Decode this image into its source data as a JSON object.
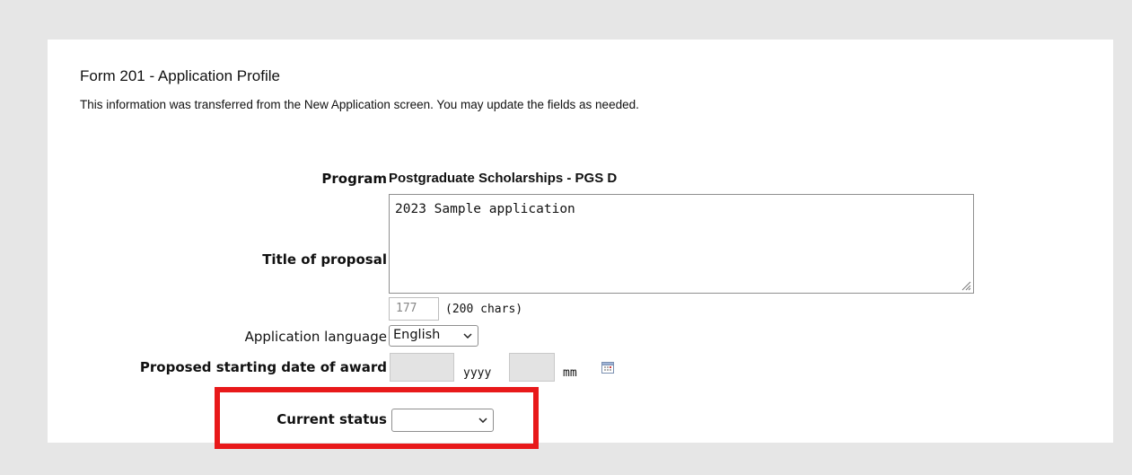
{
  "form": {
    "title": "Form 201 - Application Profile",
    "intro": "This information was transferred from the New Application screen. You may update the fields as needed."
  },
  "program": {
    "label": "Program",
    "value": "Postgraduate Scholarships - PGS D"
  },
  "proposal_title": {
    "label": "Title of proposal",
    "value": "2023 Sample application",
    "remaining_chars": "177",
    "max_chars_text": "(200 chars)"
  },
  "language": {
    "label": "Application language",
    "selected": "English"
  },
  "start_date": {
    "label": "Proposed starting date of award",
    "year_value": "",
    "year_unit": "yyyy",
    "month_value": "",
    "month_unit": "mm",
    "calendar_icon": "calendar-icon"
  },
  "current_status": {
    "label": "Current status",
    "selected": ""
  },
  "colors": {
    "highlight": "#e8191a",
    "page_background": "#e6e6e6"
  }
}
